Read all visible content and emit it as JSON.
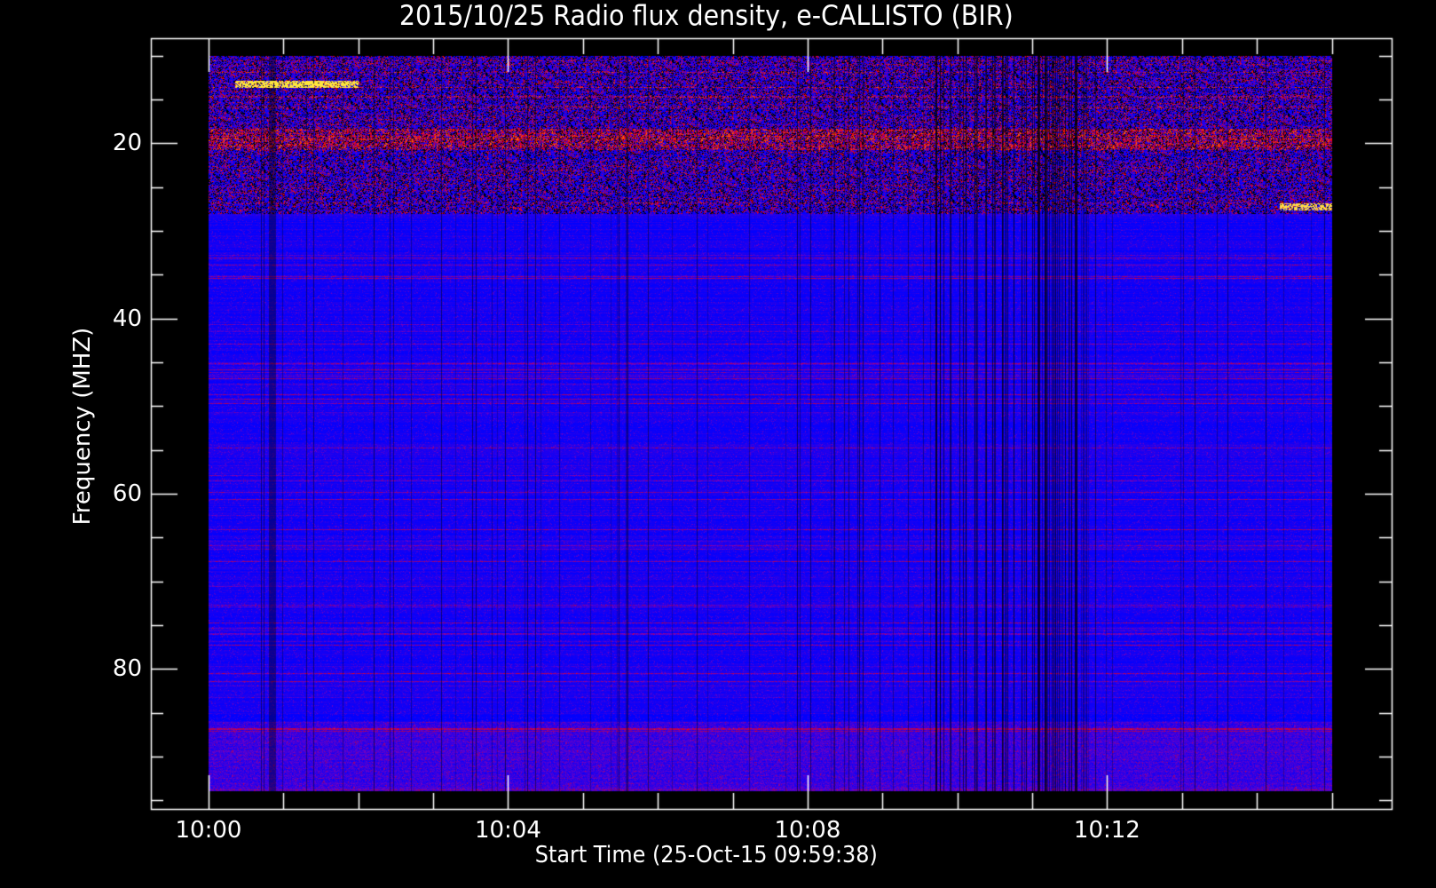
{
  "chart_data": {
    "type": "heatmap",
    "title": "2015/10/25  Radio flux density, e-CALLISTO (BIR)",
    "xlabel": "Start Time (25-Oct-15 09:59:38)",
    "ylabel": "Frequency (MHZ)",
    "x_ticks": [
      "10:00",
      "10:04",
      "10:08",
      "10:12"
    ],
    "x_tick_minutes": [
      0,
      4,
      8,
      12
    ],
    "x_minor_step_minutes": 1,
    "x_data_range_minutes": [
      0,
      15
    ],
    "x_axis_range_minutes": [
      -0.77,
      15.8
    ],
    "y_ticks": [
      "20",
      "40",
      "60",
      "80"
    ],
    "y_tick_values": [
      20,
      40,
      60,
      80
    ],
    "y_minor_step": 5,
    "y_data_range": [
      10,
      94
    ],
    "y_axis_range": [
      8,
      96
    ],
    "y_inverted": true,
    "grid": false,
    "colormap": [
      "#000000",
      "#0000ff",
      "#b00000",
      "#ff3000",
      "#ffff60"
    ],
    "background_color": "#000000",
    "axis_color": "#ffffff"
  }
}
